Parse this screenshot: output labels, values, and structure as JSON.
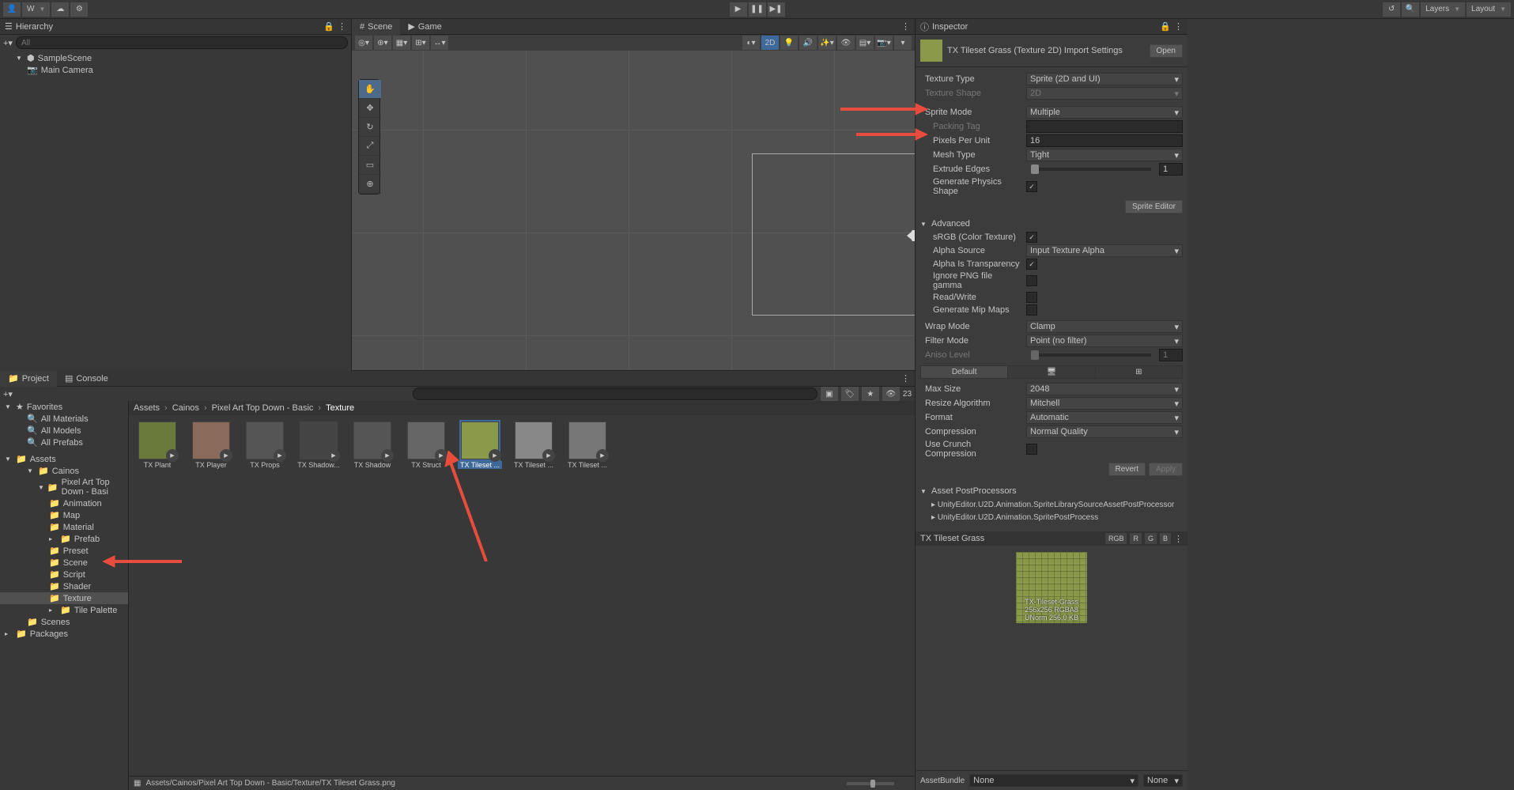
{
  "toolbar": {
    "account": "W",
    "layers": "Layers",
    "layout": "Layout"
  },
  "hierarchy": {
    "title": "Hierarchy",
    "search_placeholder": "All",
    "scene": "SampleScene",
    "items": [
      "Main Camera"
    ]
  },
  "scene": {
    "tab_scene": "Scene",
    "tab_game": "Game",
    "twod": "2D"
  },
  "project": {
    "tab_project": "Project",
    "tab_console": "Console",
    "hidden_count": "23",
    "favorites": "Favorites",
    "fav_items": [
      "All Materials",
      "All Models",
      "All Prefabs"
    ],
    "assets": "Assets",
    "tree": {
      "cainos": "Cainos",
      "pixelart": "Pixel Art Top Down - Basi",
      "folders": [
        "Animation",
        "Map",
        "Material",
        "Prefab",
        "Preset",
        "Scene",
        "Script",
        "Shader",
        "Texture",
        "Tile Palette"
      ],
      "scenes": "Scenes",
      "packages": "Packages"
    },
    "breadcrumb": [
      "Assets",
      "Cainos",
      "Pixel Art Top Down - Basic",
      "Texture"
    ],
    "items": [
      "TX Plant",
      "TX Player",
      "TX Props",
      "TX Shadow...",
      "TX Shadow",
      "TX Struct",
      "TX Tileset ...",
      "TX Tileset ...",
      "TX Tileset ..."
    ],
    "selected_index": 6,
    "footer": "Assets/Cainos/Pixel Art Top Down - Basic/Texture/TX Tileset Grass.png"
  },
  "inspector": {
    "title": "Inspector",
    "asset_title": "TX Tileset Grass (Texture 2D) Import Settings",
    "open": "Open",
    "fields": {
      "texture_type": {
        "label": "Texture Type",
        "value": "Sprite (2D and UI)"
      },
      "texture_shape": {
        "label": "Texture Shape",
        "value": "2D"
      },
      "sprite_mode": {
        "label": "Sprite Mode",
        "value": "Multiple"
      },
      "packing_tag": {
        "label": "Packing Tag",
        "value": ""
      },
      "pixels_per_unit": {
        "label": "Pixels Per Unit",
        "value": "16"
      },
      "mesh_type": {
        "label": "Mesh Type",
        "value": "Tight"
      },
      "extrude_edges": {
        "label": "Extrude Edges",
        "value": "1"
      },
      "gen_physics": {
        "label": "Generate Physics Shape",
        "checked": true
      },
      "sprite_editor": "Sprite Editor",
      "advanced": "Advanced",
      "srgb": {
        "label": "sRGB (Color Texture)",
        "checked": true
      },
      "alpha_source": {
        "label": "Alpha Source",
        "value": "Input Texture Alpha"
      },
      "alpha_trans": {
        "label": "Alpha Is Transparency",
        "checked": true
      },
      "ignore_png": {
        "label": "Ignore PNG file gamma",
        "checked": false
      },
      "readwrite": {
        "label": "Read/Write",
        "checked": false
      },
      "mipmaps": {
        "label": "Generate Mip Maps",
        "checked": false
      },
      "wrap_mode": {
        "label": "Wrap Mode",
        "value": "Clamp"
      },
      "filter_mode": {
        "label": "Filter Mode",
        "value": "Point (no filter)"
      },
      "aniso": {
        "label": "Aniso Level",
        "value": "1"
      },
      "default_tab": "Default",
      "max_size": {
        "label": "Max Size",
        "value": "2048"
      },
      "resize_algo": {
        "label": "Resize Algorithm",
        "value": "Mitchell"
      },
      "format": {
        "label": "Format",
        "value": "Automatic"
      },
      "compression": {
        "label": "Compression",
        "value": "Normal Quality"
      },
      "crunch": {
        "label": "Use Crunch Compression",
        "checked": false
      },
      "revert": "Revert",
      "apply": "Apply",
      "postprocessors": "Asset PostProcessors",
      "pp1": "UnityEditor.U2D.Animation.SpriteLibrarySourceAssetPostProcessor",
      "pp2": "UnityEditor.U2D.Animation.SpritePostProcess"
    },
    "preview": {
      "name": "TX Tileset Grass",
      "channels": [
        "RGB",
        "R",
        "G",
        "B"
      ],
      "label": "TX-Tileset-Grass",
      "info": "256x256  RGBA8 UNorm   256.0 KB"
    },
    "assetbundle": {
      "label": "AssetBundle",
      "value1": "None",
      "value2": "None"
    }
  }
}
